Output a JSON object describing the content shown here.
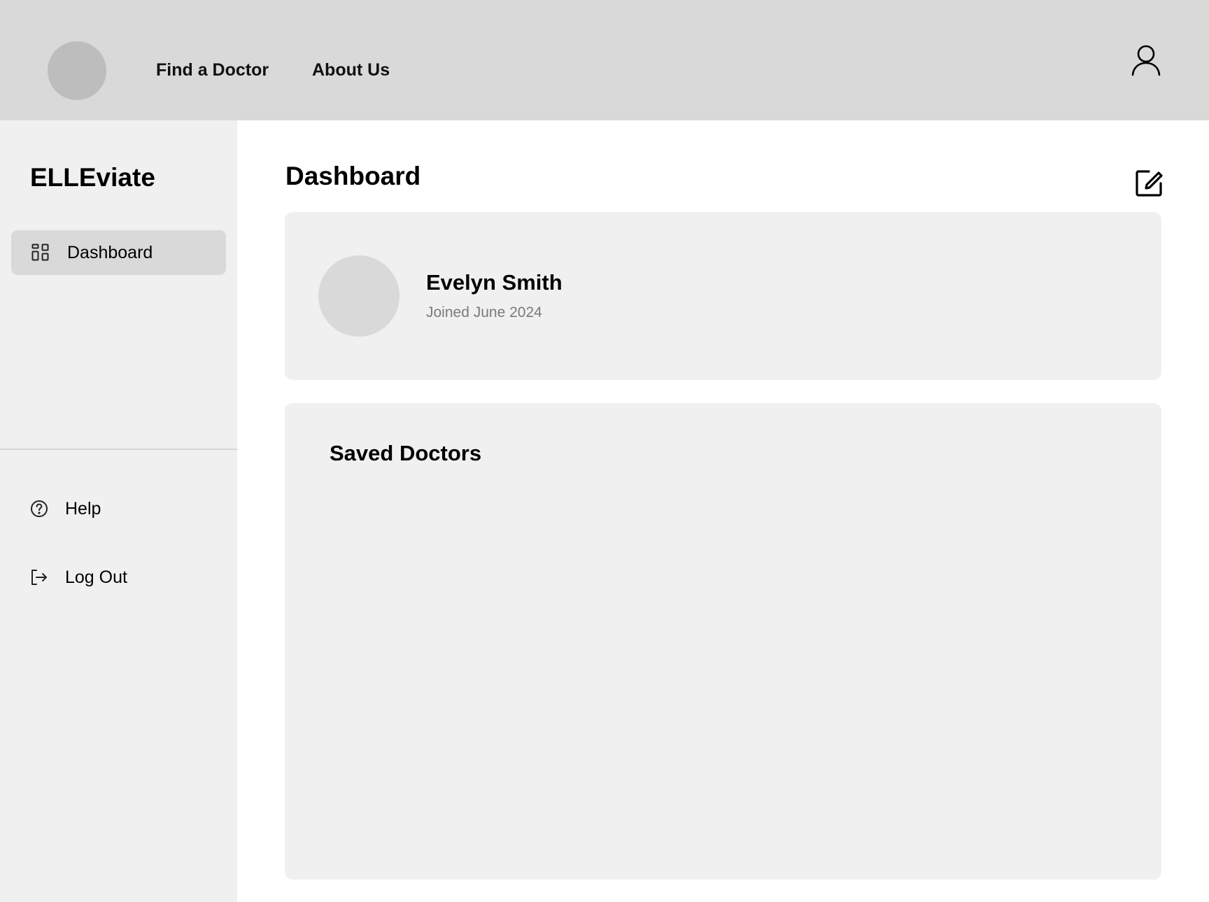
{
  "header": {
    "nav": [
      {
        "label": "Find a Doctor"
      },
      {
        "label": "About Us"
      }
    ],
    "profile_icon": "user-icon"
  },
  "sidebar": {
    "brand": "ELLEviate",
    "items": [
      {
        "label": "Dashboard",
        "icon": "grid-icon",
        "active": true
      }
    ],
    "bottom_items": [
      {
        "label": "Help",
        "icon": "help-circle-icon"
      },
      {
        "label": "Log Out",
        "icon": "logout-icon"
      }
    ]
  },
  "main": {
    "title": "Dashboard",
    "edit_icon": "edit-icon",
    "profile": {
      "name": "Evelyn Smith",
      "joined": "Joined June 2024"
    },
    "saved": {
      "title": "Saved Doctors"
    }
  },
  "colors": {
    "topbar_bg": "#d9d9d9",
    "sidebar_bg": "#f0f0f0",
    "active_item_bg": "#d9d9d9",
    "card_bg": "#f0f0f0",
    "muted_text": "#7a7a7a"
  }
}
